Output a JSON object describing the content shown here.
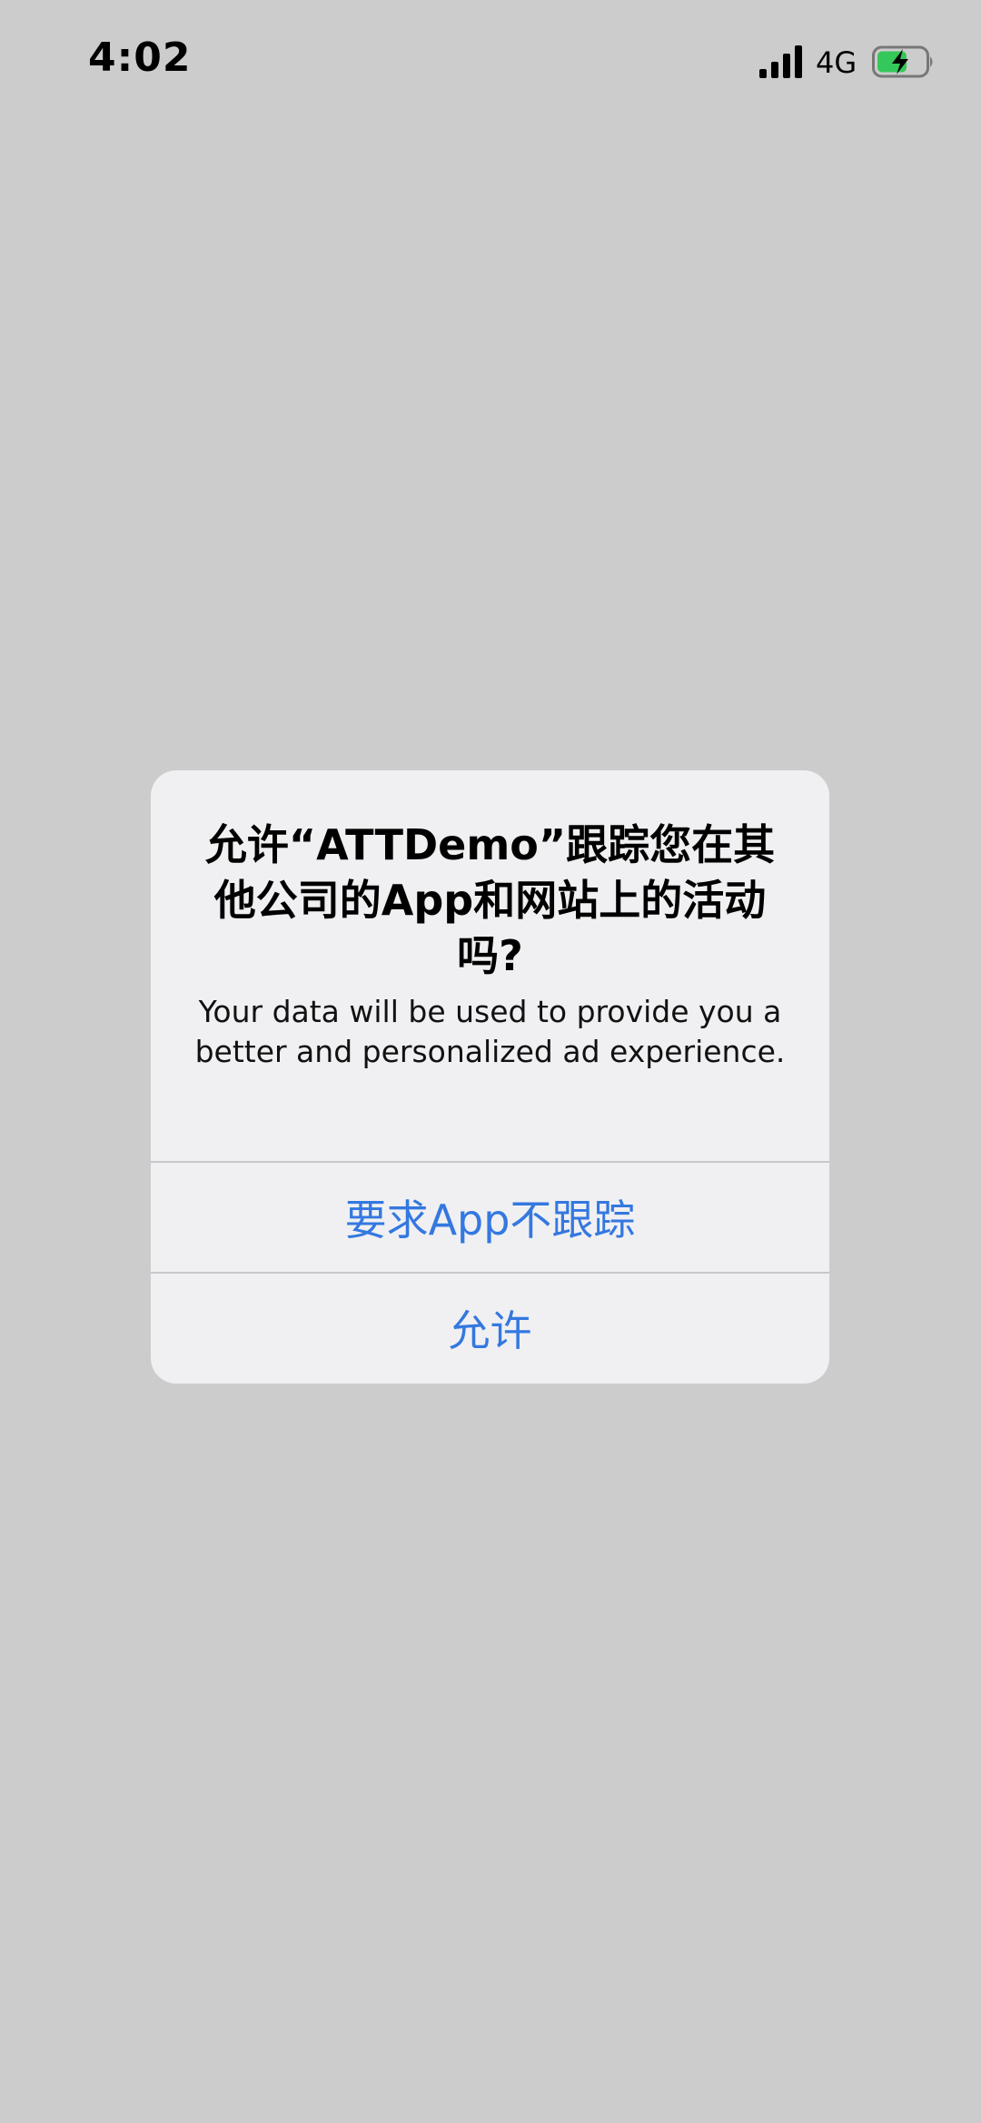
{
  "status_bar": {
    "time": "4:02",
    "network": "4G",
    "signal_icon": "signal-bars-icon",
    "battery_icon": "battery-charging-icon",
    "battery_color": "#34c759"
  },
  "alert": {
    "title": "允许“ATTDemo”跟踪您在其他公司的App和网站上的活动吗?",
    "message": "Your data will be used to provide you a better and personalized ad experience.",
    "ask_not_track_label": "要求App不跟踪",
    "allow_label": "允许",
    "button_color": "#3478e0"
  }
}
